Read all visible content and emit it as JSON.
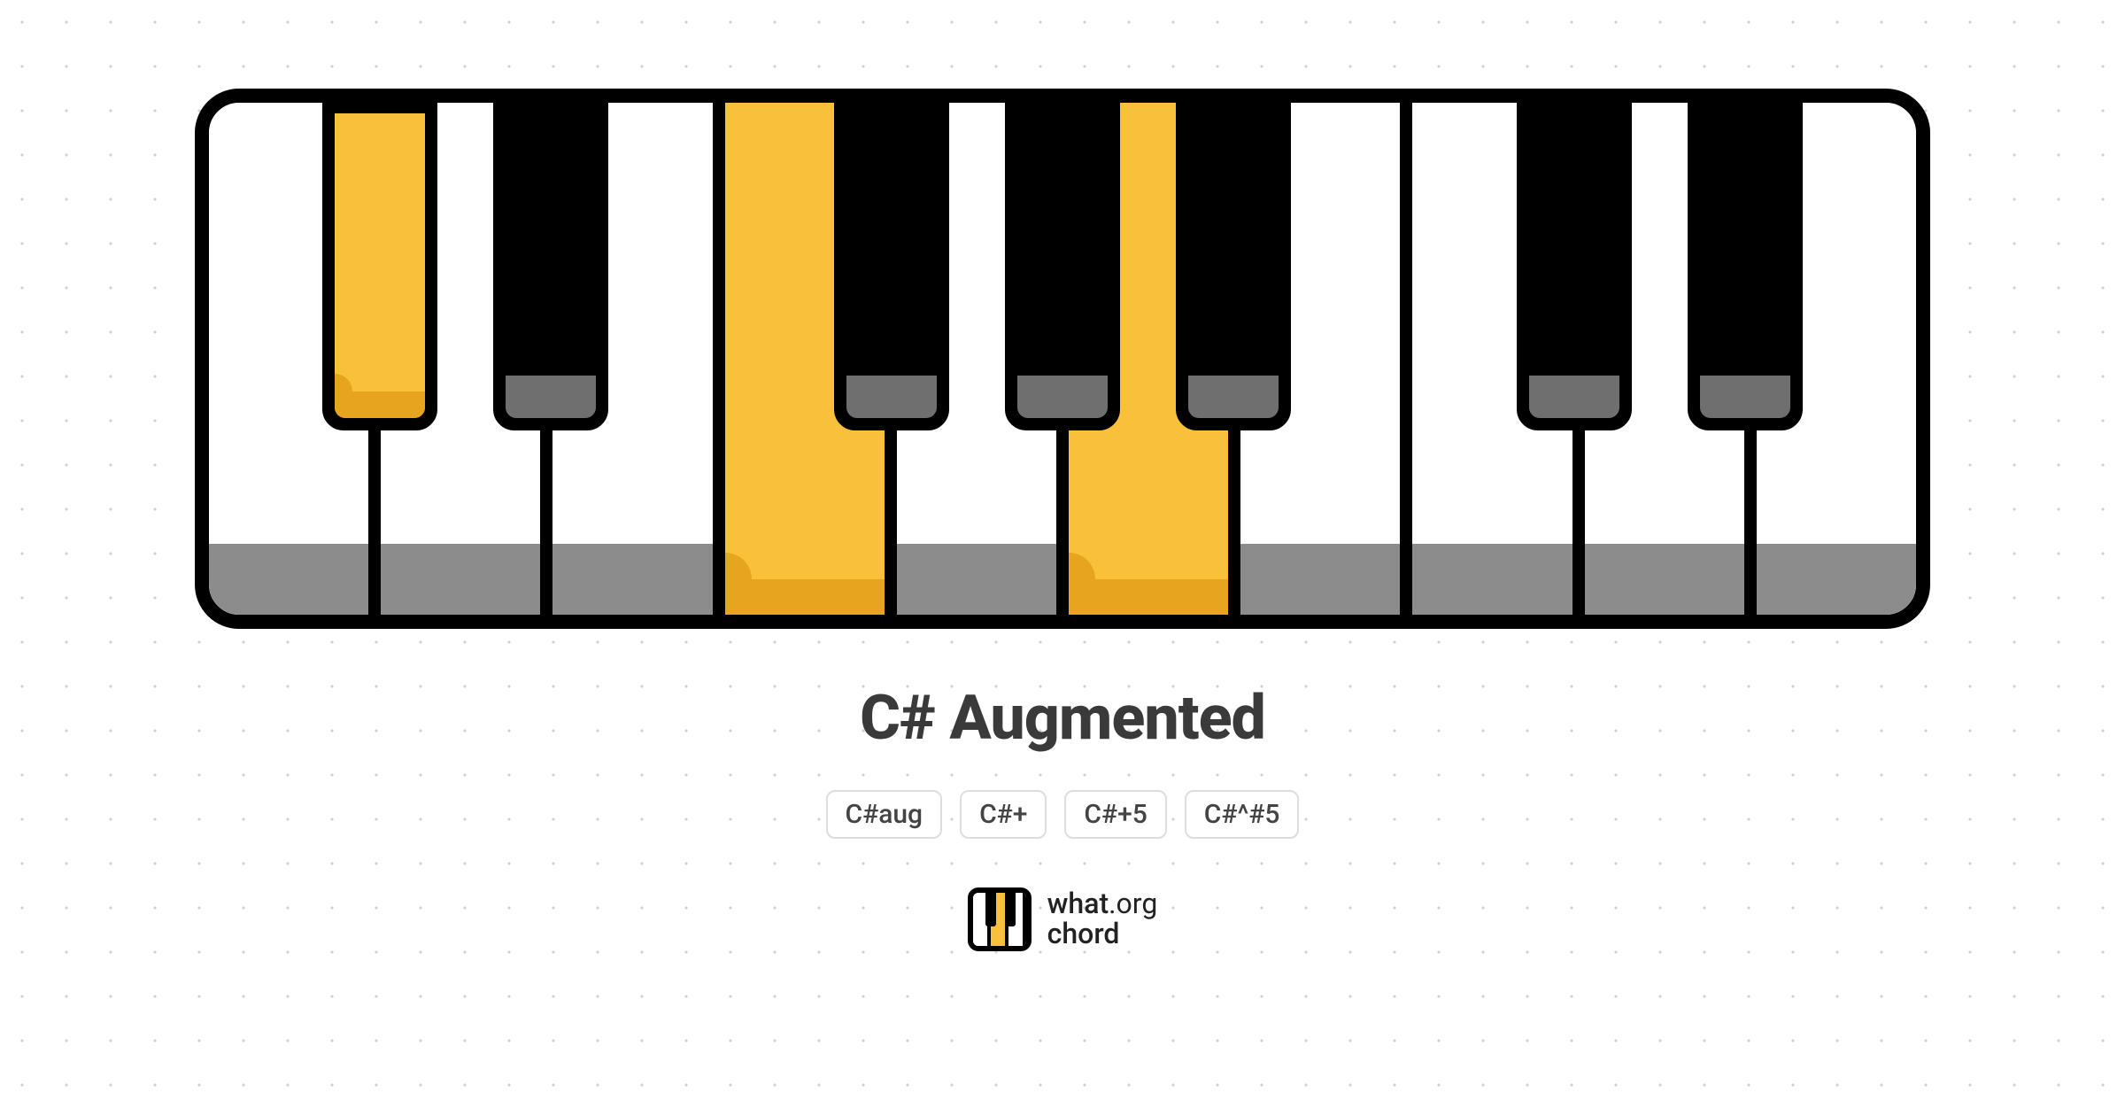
{
  "chord": {
    "name": "C# Augmented",
    "aliases": [
      "C#aug",
      "C#+",
      "C#+5",
      "C#^#5"
    ]
  },
  "keyboard": {
    "white_keys": [
      {
        "note": "C",
        "highlighted": false
      },
      {
        "note": "D",
        "highlighted": false
      },
      {
        "note": "E",
        "highlighted": false
      },
      {
        "note": "F",
        "highlighted": true
      },
      {
        "note": "G",
        "highlighted": false
      },
      {
        "note": "A",
        "highlighted": true
      },
      {
        "note": "B",
        "highlighted": false
      },
      {
        "note": "C",
        "highlighted": false
      },
      {
        "note": "D",
        "highlighted": false
      },
      {
        "note": "E",
        "highlighted": false
      }
    ],
    "black_keys": [
      {
        "note": "C#",
        "position": 0,
        "highlighted": true
      },
      {
        "note": "D#",
        "position": 1,
        "highlighted": false
      },
      {
        "note": "F#",
        "position": 3,
        "highlighted": false
      },
      {
        "note": "G#",
        "position": 4,
        "highlighted": false
      },
      {
        "note": "A#",
        "position": 5,
        "highlighted": false
      },
      {
        "note": "C#",
        "position": 7,
        "highlighted": false
      },
      {
        "note": "D#",
        "position": 8,
        "highlighted": false
      }
    ]
  },
  "brand": {
    "line1_a": "what",
    "line1_b": ".org",
    "line2": "chord"
  }
}
